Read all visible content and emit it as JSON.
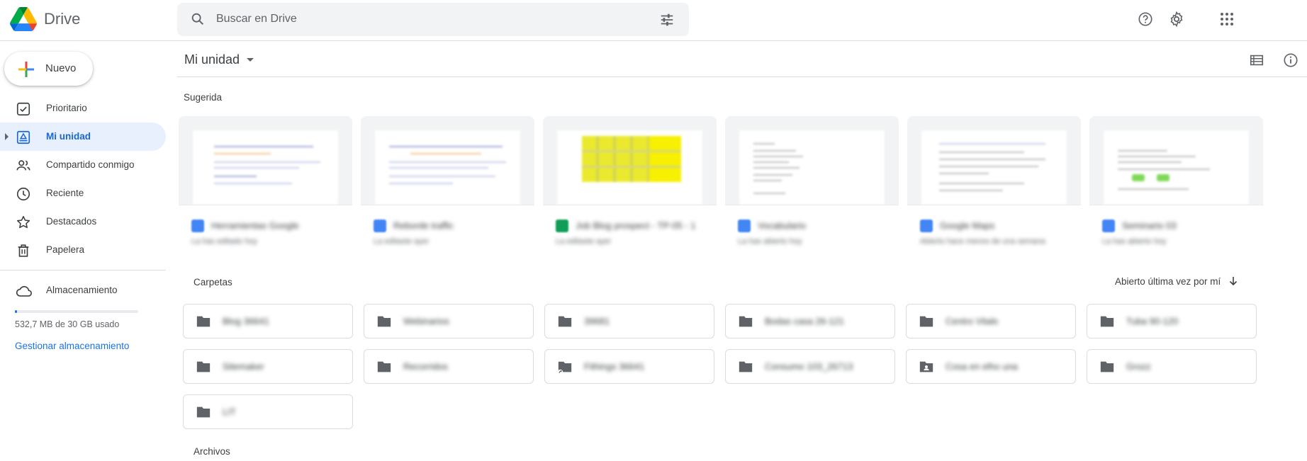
{
  "app": {
    "name": "Drive"
  },
  "search": {
    "placeholder": "Buscar en Drive"
  },
  "header": {
    "icons": [
      "search-icon",
      "tune-icon",
      "help-icon",
      "settings-icon",
      "apps-grid-icon"
    ]
  },
  "sidebar": {
    "new_label": "Nuevo",
    "items": [
      {
        "label": "Prioritario",
        "icon": "priority-check-icon"
      },
      {
        "label": "Mi unidad",
        "icon": "my-drive-icon",
        "active": true
      },
      {
        "label": "Compartido conmigo",
        "icon": "people-icon"
      },
      {
        "label": "Reciente",
        "icon": "clock-icon"
      },
      {
        "label": "Destacados",
        "icon": "star-icon"
      },
      {
        "label": "Papelera",
        "icon": "trash-icon"
      }
    ],
    "storage": {
      "label": "Almacenamiento",
      "usage_text": "532,7 MB de 30 GB usado",
      "usage_fraction": 0.018,
      "manage_label": "Gestionar almacenamiento"
    }
  },
  "main": {
    "title": "Mi unidad",
    "suggested_label": "Sugerida",
    "folders_label": "Carpetas",
    "files_label": "Archivos",
    "sort_label": "Abierto última vez por mí",
    "suggested": [
      {
        "name": "Herramientas Google",
        "meta": "La has editado hoy",
        "color": "#4285f4"
      },
      {
        "name": "Reborde traffic",
        "meta": "La editaste ayer",
        "color": "#4285f4"
      },
      {
        "name": "Job Blog prospect - TP-05 - 1",
        "meta": "La editaste ayer",
        "color": "#0f9d58"
      },
      {
        "name": "Vocabulario",
        "meta": "La has abierto hoy",
        "color": "#4285f4"
      },
      {
        "name": "Google Maps",
        "meta": "Abierto hace menos de una semana",
        "color": "#4285f4"
      },
      {
        "name": "Seminario 03",
        "meta": "La has abierto hoy",
        "color": "#4285f4"
      }
    ],
    "folders": [
      {
        "name": "Blog 36641",
        "type": "folder"
      },
      {
        "name": "Webinarios",
        "type": "folder"
      },
      {
        "name": "39681",
        "type": "folder"
      },
      {
        "name": "Bodas casa 26-121",
        "type": "folder"
      },
      {
        "name": "Centro Vitals",
        "type": "folder"
      },
      {
        "name": "Tuba 90-120",
        "type": "folder"
      },
      {
        "name": "Sitemaker",
        "type": "folder"
      },
      {
        "name": "Recorridos",
        "type": "folder"
      },
      {
        "name": "Fithings 36641",
        "type": "shortcut-folder"
      },
      {
        "name": "Consumo 103_26713",
        "type": "folder"
      },
      {
        "name": "Cosa en elho una",
        "type": "shared-folder"
      },
      {
        "name": "Grozz",
        "type": "folder"
      },
      {
        "name": "LIT",
        "type": "folder"
      }
    ]
  },
  "colors": {
    "accent": "#1a73e8",
    "active_bg": "#e8f0fe",
    "active_text": "#1967d2"
  }
}
